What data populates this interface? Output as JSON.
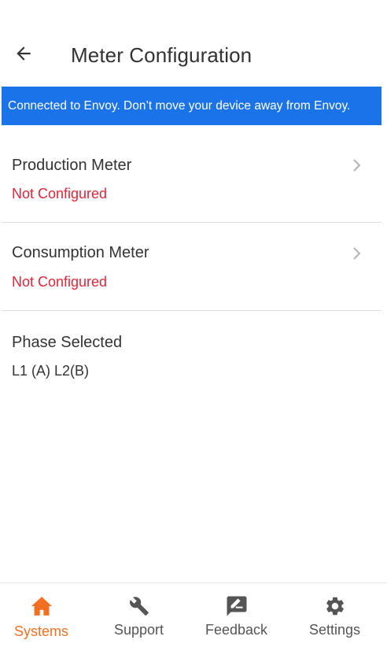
{
  "header": {
    "title": "Meter Configuration",
    "back_icon": "arrow-left-icon"
  },
  "banner": {
    "text": "Connected to Envoy. Don’t move your device away from Envoy.",
    "color": "#1a73e8"
  },
  "meters": [
    {
      "title": "Production Meter",
      "status": "Not Configured",
      "status_color": "#e0263b"
    },
    {
      "title": "Consumption Meter",
      "status": "Not Configured",
      "status_color": "#e0263b"
    }
  ],
  "phase": {
    "title": "Phase Selected",
    "value": "L1 (A) L2(B)"
  },
  "bottom_nav": {
    "active_color": "#f37021",
    "items": [
      {
        "label": "Systems",
        "icon": "home-icon",
        "active": true
      },
      {
        "label": "Support",
        "icon": "wrench-icon",
        "active": false
      },
      {
        "label": "Feedback",
        "icon": "feedback-icon",
        "active": false
      },
      {
        "label": "Settings",
        "icon": "gear-icon",
        "active": false
      }
    ]
  }
}
